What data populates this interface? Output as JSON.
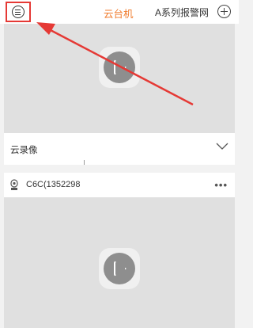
{
  "header": {
    "menu_icon": "menu-icon",
    "active_tab": "云台机",
    "other_tab": "A系列报警网",
    "add_icon": "add-icon"
  },
  "cloud_recording": {
    "label": "云录像",
    "expand_icon": "chevron-down-icon"
  },
  "camera": {
    "icon": "camera-icon",
    "name": "C6C(1352298",
    "more_icon": "more-dots-icon",
    "more_text": "•••"
  },
  "colors": {
    "accent": "#f07a2b",
    "annotation": "#e53935"
  }
}
